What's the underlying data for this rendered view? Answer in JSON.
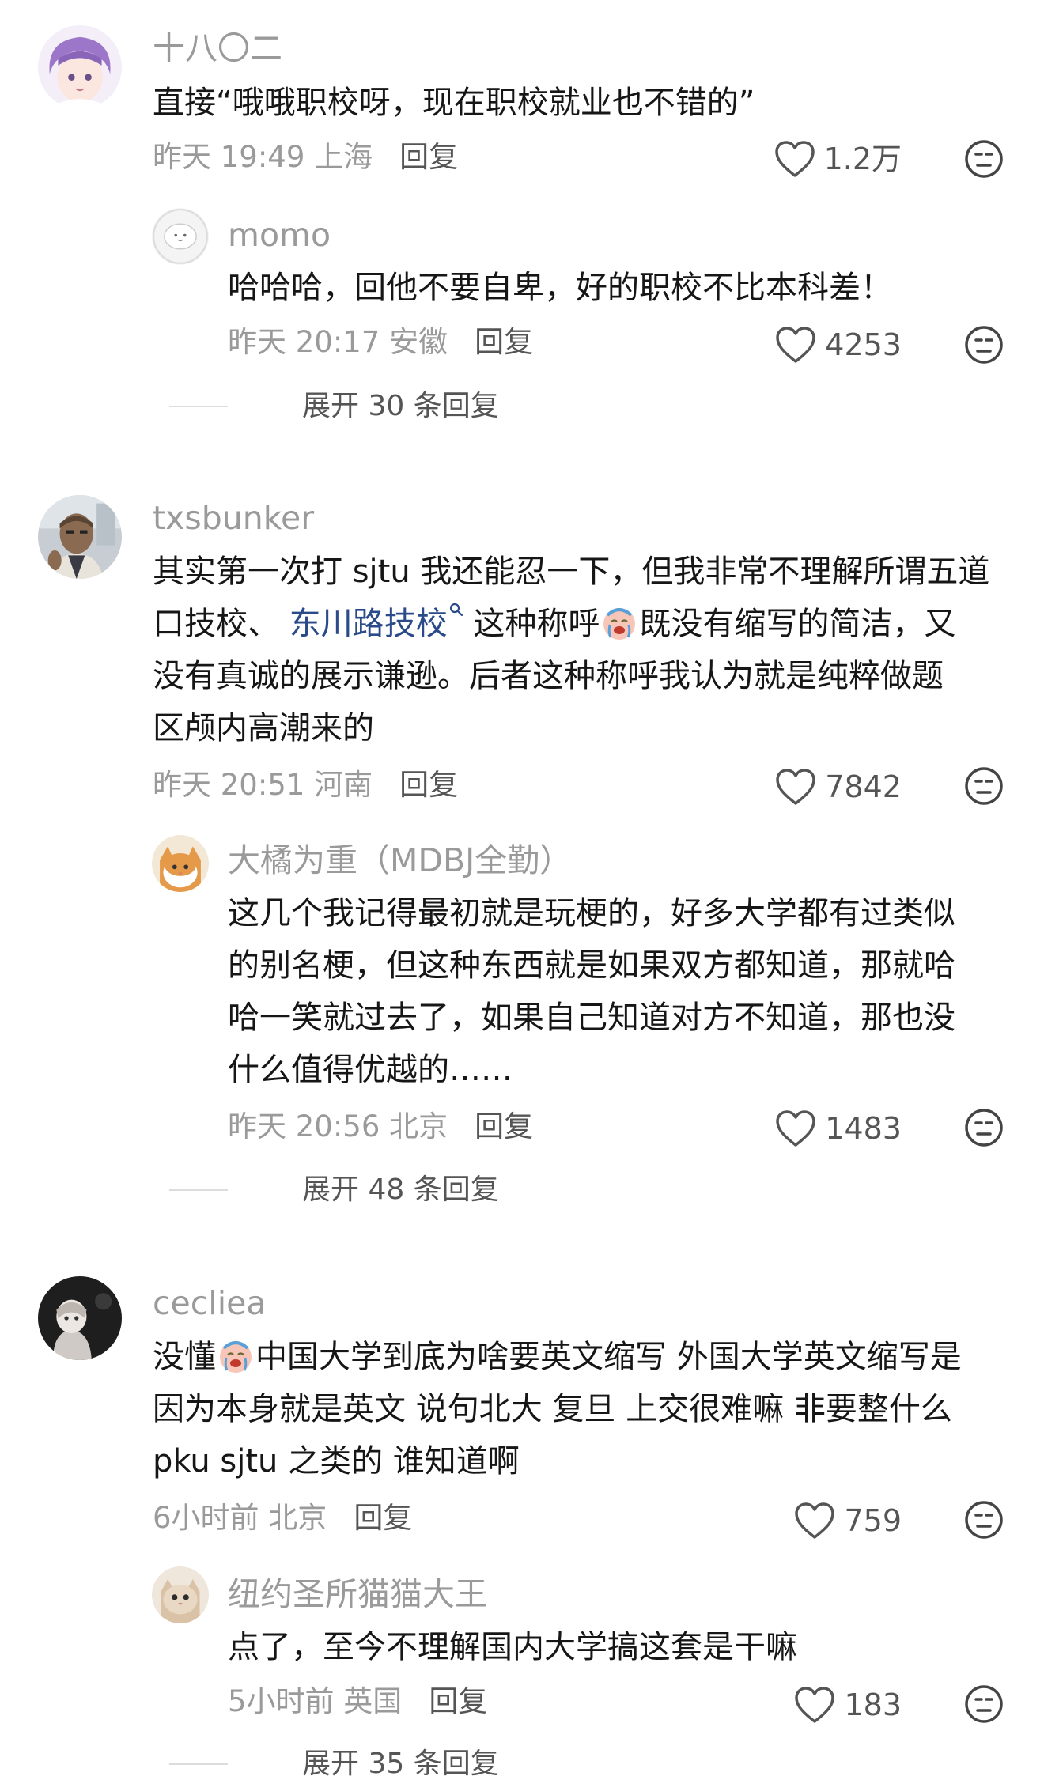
{
  "comments": [
    {
      "username": "十八〇二",
      "body": [
        "直接“哦哦职校呀，现在职校就业也不错的”"
      ],
      "time": "昨天 19:49 上海",
      "reply_label": "回复",
      "likes": "1.2万",
      "replies": [
        {
          "username": "momo",
          "body": [
            "哈哈哈，回他不要自卑，好的职校不比本科差！"
          ],
          "time": "昨天 20:17 安徽",
          "reply_label": "回复",
          "likes": "4253"
        }
      ],
      "expand_label": "展开 30 条回复"
    },
    {
      "username": "txsbunker",
      "body_line1": "其实第一次打 sjtu 我还能忍一下，但我非常不理解所谓五道",
      "body_line2_a": "口技校、 ",
      "body_line2_link": "东川路技校",
      "body_line2_b": " 这种称呼",
      "body_line2_c": "既没有缩写的简洁，又",
      "body_line3": "没有真诚的展示谦逊。后者这种称呼我认为就是纯粹做题",
      "body_line4": "区颅内高潮来的",
      "time": "昨天 20:51 河南",
      "reply_label": "回复",
      "likes": "7842",
      "replies": [
        {
          "username": "大橘为重（MDBJ全勤）",
          "body": [
            "这几个我记得最初就是玩梗的，好多大学都有过类似",
            "的别名梗，但这种东西就是如果双方都知道，那就哈",
            "哈一笑就过去了，如果自己知道对方不知道，那也没",
            "什么值得优越的……"
          ],
          "time": "昨天 20:56 北京",
          "reply_label": "回复",
          "likes": "1483"
        }
      ],
      "expand_label": "展开 48 条回复"
    },
    {
      "username": "cecliea",
      "body_line1_a": "没懂",
      "body_line1_b": "中国大学到底为啥要英文缩写 外国大学英文缩写是",
      "body_line2": "因为本身就是英文 说句北大 复旦 上交很难嘛 非要整什么",
      "body_line3": "pku sjtu 之类的 谁知道啊",
      "time": "6小时前 北京",
      "reply_label": "回复",
      "likes": "759",
      "replies": [
        {
          "username": "纽约圣所猫猫大王",
          "body": [
            "点了，至今不理解国内大学搞这套是干嘛"
          ],
          "time": "5小时前 英国",
          "reply_label": "回复",
          "likes": "183"
        }
      ],
      "expand_label": "展开 35 条回复"
    }
  ],
  "icons": {
    "like": "heart-outline-icon",
    "dislike": "neutral-face-icon",
    "emoji": "crying-face-emoji",
    "search": "search-icon"
  },
  "colors": {
    "username": "#9a9a9a",
    "body": "#161616",
    "link": "#2a4a8a",
    "meta": "#9a9a9a"
  }
}
